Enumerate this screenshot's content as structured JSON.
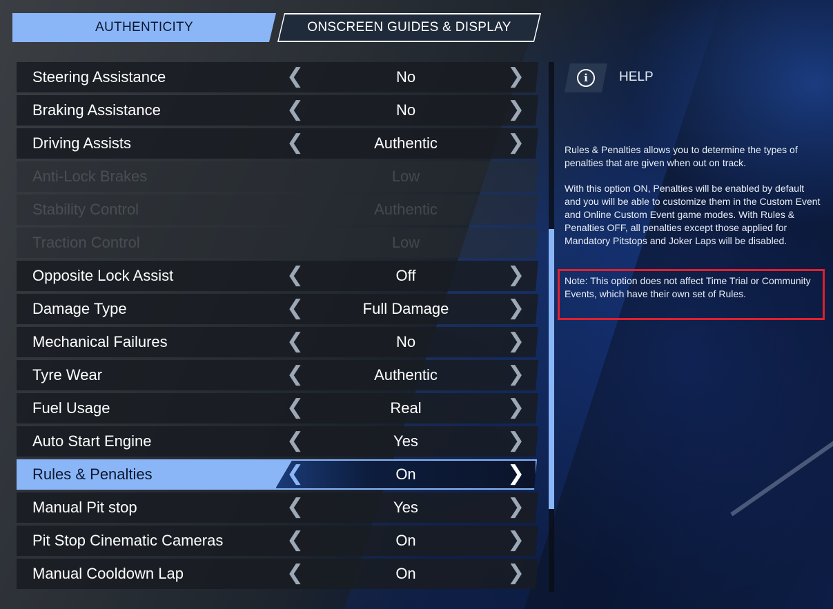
{
  "tabs": [
    {
      "label": "AUTHENTICITY",
      "active": true
    },
    {
      "label": "ONSCREEN GUIDES & DISPLAY",
      "active": false
    }
  ],
  "settings": [
    {
      "label": "Steering Assistance",
      "value": "No",
      "enabled": true
    },
    {
      "label": "Braking Assistance",
      "value": "No",
      "enabled": true
    },
    {
      "label": "Driving Assists",
      "value": "Authentic",
      "enabled": true
    },
    {
      "label": "Anti-Lock Brakes",
      "value": "Low",
      "enabled": false
    },
    {
      "label": "Stability Control",
      "value": "Authentic",
      "enabled": false
    },
    {
      "label": "Traction Control",
      "value": "Low",
      "enabled": false
    },
    {
      "label": "Opposite Lock Assist",
      "value": "Off",
      "enabled": true
    },
    {
      "label": "Damage Type",
      "value": "Full Damage",
      "enabled": true
    },
    {
      "label": "Mechanical Failures",
      "value": "No",
      "enabled": true
    },
    {
      "label": "Tyre Wear",
      "value": "Authentic",
      "enabled": true
    },
    {
      "label": "Fuel Usage",
      "value": "Real",
      "enabled": true
    },
    {
      "label": "Auto Start Engine",
      "value": "Yes",
      "enabled": true
    },
    {
      "label": "Rules & Penalties",
      "value": "On",
      "enabled": true,
      "selected": true
    },
    {
      "label": "Manual Pit stop",
      "value": "Yes",
      "enabled": true
    },
    {
      "label": "Pit Stop Cinematic Cameras",
      "value": "On",
      "enabled": true
    },
    {
      "label": "Manual Cooldown Lap",
      "value": "On",
      "enabled": true
    }
  ],
  "arrows": {
    "left": "❮",
    "right": "❯"
  },
  "help": {
    "icon": "info-icon",
    "icon_glyph": "i",
    "title": "HELP",
    "paragraph1": "Rules & Penalties allows you to determine the types of penalties that are given when out on track.",
    "paragraph2": "With this option ON, Penalties will be enabled by default and you will be able to customize them in the Custom Event and Online Custom Event game modes. With Rules & Penalties OFF, all penalties except those applied for Mandatory Pitstops and Joker Laps will be disabled.",
    "note": "Note: This option does not affect Time Trial or Community Events, which have their own set of Rules."
  },
  "colors": {
    "accent": "#8ab6f7",
    "highlight_box": "#e0202e"
  }
}
